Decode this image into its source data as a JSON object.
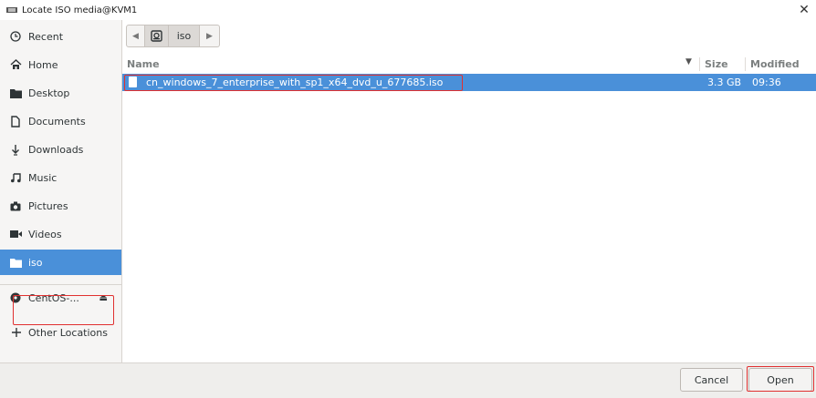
{
  "window": {
    "title": "Locate ISO media@KVM1"
  },
  "sidebar": {
    "items": [
      {
        "label": "Recent",
        "icon": "clock-icon"
      },
      {
        "label": "Home",
        "icon": "home-icon"
      },
      {
        "label": "Desktop",
        "icon": "folder-icon"
      },
      {
        "label": "Documents",
        "icon": "document-icon"
      },
      {
        "label": "Downloads",
        "icon": "download-icon"
      },
      {
        "label": "Music",
        "icon": "music-icon"
      },
      {
        "label": "Pictures",
        "icon": "camera-icon"
      },
      {
        "label": "Videos",
        "icon": "video-icon"
      },
      {
        "label": "iso",
        "icon": "folder-icon",
        "selected": true
      }
    ],
    "devices": [
      {
        "label": "CentOS-...",
        "icon": "disc-icon"
      }
    ],
    "other_locations": {
      "label": "Other Locations",
      "icon": "plus-icon"
    }
  },
  "pathbar": {
    "current": "iso"
  },
  "filelist": {
    "columns": {
      "name": "Name",
      "size": "Size",
      "modified": "Modified"
    },
    "rows": [
      {
        "name": "cn_windows_7_enterprise_with_sp1_x64_dvd_u_677685.iso",
        "size": "3.3 GB",
        "modified": "09:36",
        "selected": true
      }
    ]
  },
  "footer": {
    "cancel_label": "Cancel",
    "open_label": "Open"
  },
  "colors": {
    "accent": "#4a90d9",
    "highlight_box": "#e03030"
  }
}
